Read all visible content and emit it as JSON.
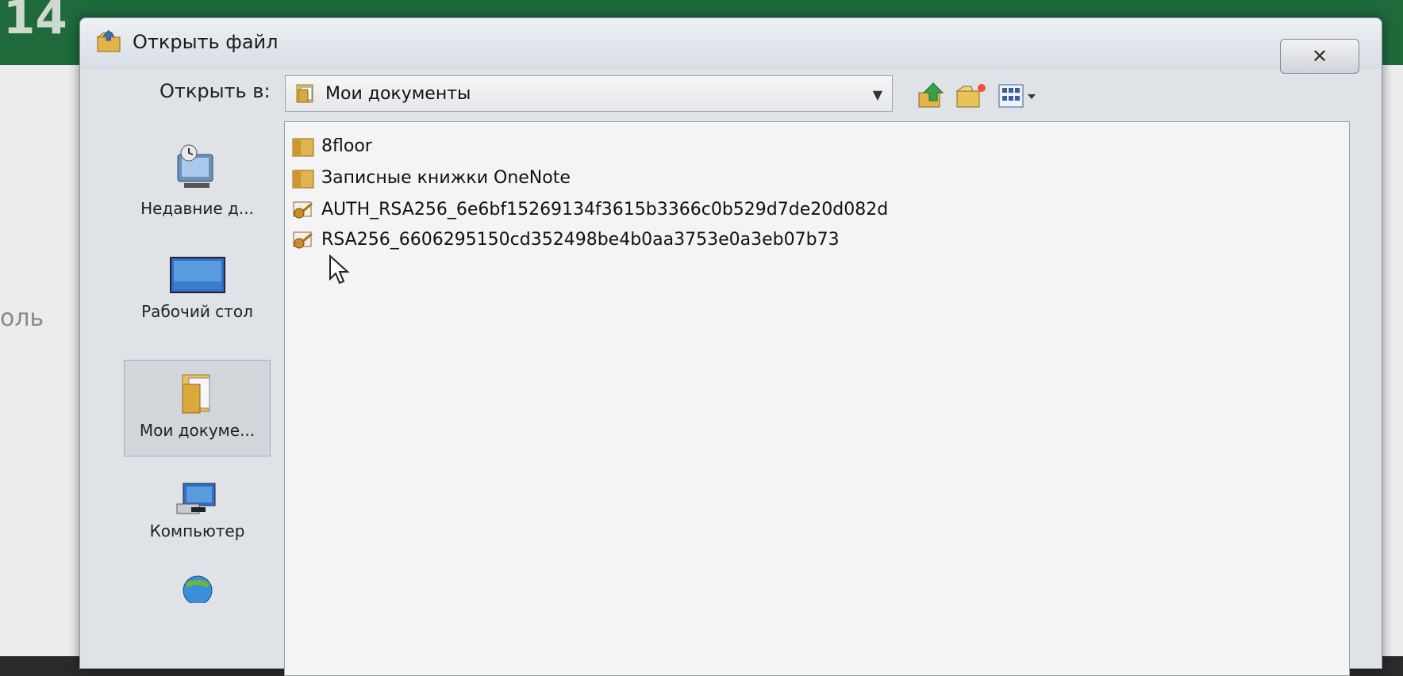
{
  "background": {
    "header_number": "14",
    "side_label": "оль"
  },
  "dialog": {
    "title": "Открыть файл",
    "close_symbol": "✕",
    "look_in_label": "Открыть в:",
    "look_in_value": "Мои документы",
    "toolbar_icons": [
      "up-one-level-icon",
      "new-folder-icon",
      "views-menu-icon"
    ]
  },
  "places": [
    {
      "label": "Недавние д...",
      "icon": "recent-documents-icon"
    },
    {
      "label": "Рабочий стол",
      "icon": "desktop-icon"
    },
    {
      "label": "Мои докуме...",
      "icon": "my-documents-icon",
      "selected": true
    },
    {
      "label": "Компьютер",
      "icon": "computer-icon"
    },
    {
      "label": "",
      "icon": "network-icon"
    }
  ],
  "files": [
    {
      "name": "8floor",
      "icon": "folder-icon"
    },
    {
      "name": "Записные книжки OneNote",
      "icon": "folder-icon"
    },
    {
      "name": "AUTH_RSA256_6e6bf15269134f3615b3366c0b529d7de20d082d",
      "icon": "certificate-key-icon"
    },
    {
      "name": "RSA256_6606295150cd352498be4b0aa3753e0a3eb07b73",
      "icon": "certificate-key-icon"
    }
  ],
  "colors": {
    "app_header": "#1e6a3b",
    "dialog_bg": "#dfe3e8",
    "selection": "#d2d5da"
  }
}
